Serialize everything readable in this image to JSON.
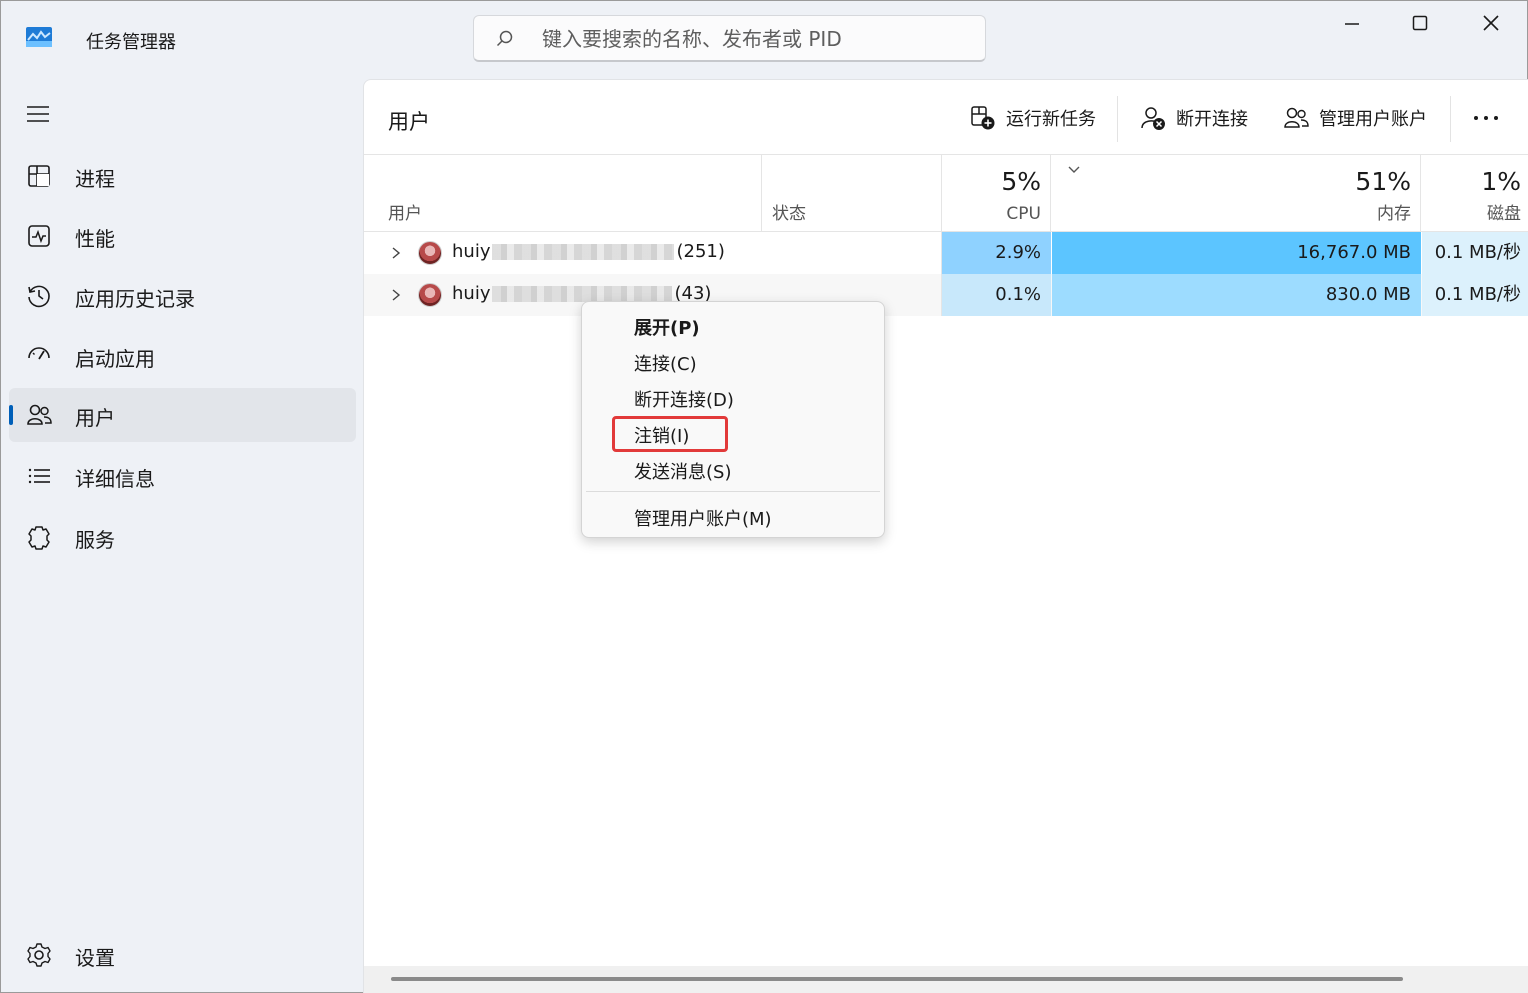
{
  "app": {
    "title": "任务管理器"
  },
  "search": {
    "placeholder": "键入要搜索的名称、发布者或 PID"
  },
  "sidebar": {
    "items": [
      {
        "label": "进程",
        "icon": "processes-icon"
      },
      {
        "label": "性能",
        "icon": "performance-icon"
      },
      {
        "label": "应用历史记录",
        "icon": "history-icon"
      },
      {
        "label": "启动应用",
        "icon": "startup-icon"
      },
      {
        "label": "用户",
        "icon": "users-icon",
        "active": true
      },
      {
        "label": "详细信息",
        "icon": "details-icon"
      },
      {
        "label": "服务",
        "icon": "services-icon"
      }
    ],
    "settings_label": "设置"
  },
  "page": {
    "title": "用户",
    "toolbar": {
      "run_new_task": "运行新任务",
      "disconnect": "断开连接",
      "manage_accounts": "管理用户账户"
    }
  },
  "table": {
    "columns": {
      "user": "用户",
      "status": "状态",
      "cpu_pct": "5%",
      "cpu": "CPU",
      "mem_pct": "51%",
      "mem": "内存",
      "disk_pct": "1%",
      "disk": "磁盘"
    },
    "rows": [
      {
        "name_prefix": "huiy",
        "count": "(251)",
        "status": "",
        "cpu": "2.9%",
        "mem": "16,767.0 MB",
        "disk": "0.1 MB/秒"
      },
      {
        "name_prefix": "huiy",
        "count": "(43)",
        "status": "",
        "cpu": "0.1%",
        "mem": "830.0 MB",
        "disk": "0.1 MB/秒"
      }
    ]
  },
  "context_menu": {
    "items": [
      {
        "label": "展开(P)",
        "bold": true
      },
      {
        "label": "连接(C)"
      },
      {
        "label": "断开连接(D)"
      },
      {
        "label": "注销(I)",
        "highlighted": true
      },
      {
        "label": "发送消息(S)"
      },
      {
        "label": "管理用户账户(M)"
      }
    ]
  },
  "colors": {
    "accent": "#005fb8",
    "cpu_high": "#8fd2ff",
    "cpu_low": "#c8e8fb",
    "mem_high": "#5cc5ff",
    "mem_mid": "#9ddcff",
    "disk": "#dcf1fc",
    "highlight_box": "#e23a3a"
  }
}
